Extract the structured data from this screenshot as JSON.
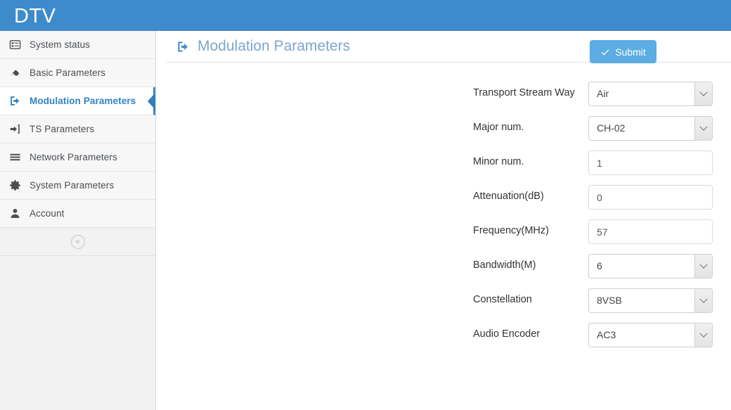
{
  "header": {
    "brand": "DTV",
    "bar_color": "#3e8bcc"
  },
  "sidebar": {
    "collapse_label": "«",
    "items": [
      {
        "label": "System status",
        "icon": "list-alt-icon",
        "active": false
      },
      {
        "label": "Basic Parameters",
        "icon": "eraser-icon",
        "active": false
      },
      {
        "label": "Modulation Parameters",
        "icon": "sign-out-icon",
        "active": true
      },
      {
        "label": "TS Parameters",
        "icon": "sign-in-icon",
        "active": false
      },
      {
        "label": "Network Parameters",
        "icon": "bars-icon",
        "active": false
      },
      {
        "label": "System Parameters",
        "icon": "gear-icon",
        "active": false
      },
      {
        "label": "Account",
        "icon": "user-icon",
        "active": false
      }
    ]
  },
  "main": {
    "title": "Modulation Parameters",
    "title_icon": "sign-out-icon",
    "title_color": "#7ba7cc",
    "fields": [
      {
        "label": "Transport Stream Way",
        "type": "select",
        "value": "Air"
      },
      {
        "label": "Major num.",
        "type": "select",
        "value": "CH-02"
      },
      {
        "label": "Minor num.",
        "type": "text",
        "value": "1"
      },
      {
        "label": "Attenuation(dB)",
        "type": "text",
        "value": "0"
      },
      {
        "label": "Frequency(MHz)",
        "type": "text",
        "value": "57"
      },
      {
        "label": "Bandwidth(M)",
        "type": "select",
        "value": "6"
      },
      {
        "label": "Constellation",
        "type": "select",
        "value": "8VSB"
      },
      {
        "label": "Audio Encoder",
        "type": "select",
        "value": "AC3"
      }
    ],
    "submit": {
      "label": "Submit",
      "icon": "check-icon",
      "color": "#5bade3"
    }
  }
}
